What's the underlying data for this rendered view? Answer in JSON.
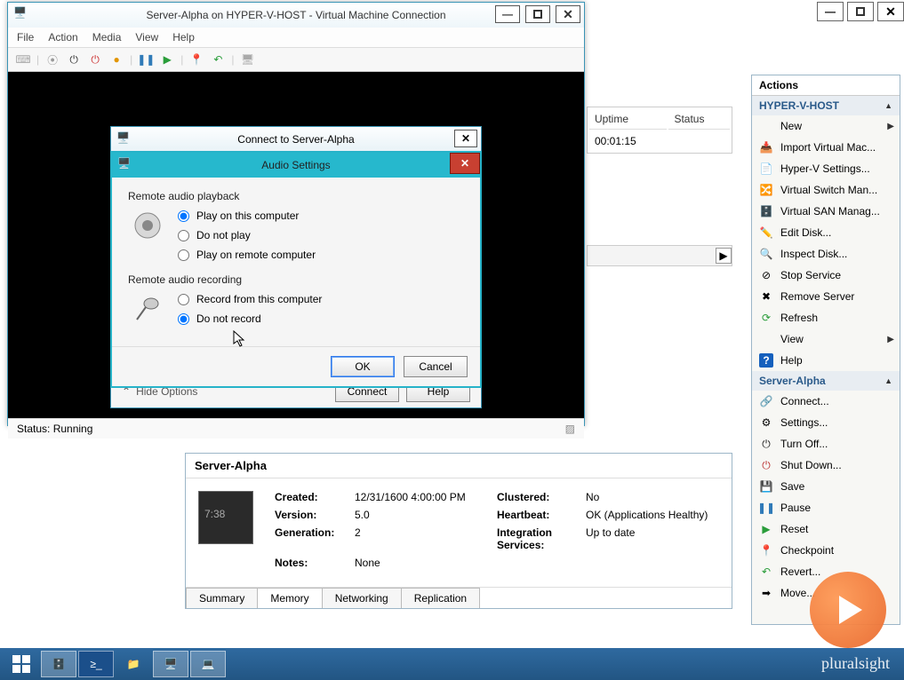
{
  "host_window": {
    "min": "—",
    "max": "❐",
    "close": "✕"
  },
  "vmconnect": {
    "title": "Server-Alpha on HYPER-V-HOST - Virtual Machine Connection",
    "menu": {
      "file": "File",
      "action": "Action",
      "media": "Media",
      "view": "View",
      "help": "Help"
    },
    "status_label": "Status: Running"
  },
  "connect_dlg": {
    "title": "Connect to Server-Alpha",
    "hide_options": "Hide Options",
    "connect": "Connect",
    "help": "Help"
  },
  "audio_dlg": {
    "title": "Audio Settings",
    "playback_label": "Remote audio playback",
    "playback_opt1": "Play on this computer",
    "playback_opt2": "Do not play",
    "playback_opt3": "Play on remote computer",
    "recording_label": "Remote audio recording",
    "recording_opt1": "Record from this computer",
    "recording_opt2": "Do not record",
    "ok": "OK",
    "cancel": "Cancel"
  },
  "vm_list": {
    "col_uptime": "Uptime",
    "col_status": "Status",
    "row0_uptime": "00:01:15"
  },
  "vm_details": {
    "name": "Server-Alpha",
    "thumb_time": "7:38",
    "created_lbl": "Created:",
    "created_val": "12/31/1600 4:00:00 PM",
    "version_lbl": "Version:",
    "version_val": "5.0",
    "generation_lbl": "Generation:",
    "generation_val": "2",
    "notes_lbl": "Notes:",
    "notes_val": "None",
    "clustered_lbl": "Clustered:",
    "clustered_val": "No",
    "heartbeat_lbl": "Heartbeat:",
    "heartbeat_val": "OK (Applications Healthy)",
    "integ_lbl": "Integration Services:",
    "integ_val": "Up to date",
    "tabs": {
      "summary": "Summary",
      "memory": "Memory",
      "networking": "Networking",
      "replication": "Replication"
    }
  },
  "actions": {
    "title": "Actions",
    "host_section": "HYPER-V-HOST",
    "vm_section": "Server-Alpha",
    "new": "New",
    "import": "Import Virtual Mac...",
    "hvsettings": "Hyper-V Settings...",
    "vswitch": "Virtual Switch Man...",
    "vsan": "Virtual SAN Manag...",
    "editdisk": "Edit Disk...",
    "inspectdisk": "Inspect Disk...",
    "stopservice": "Stop Service",
    "removeserver": "Remove Server",
    "refresh": "Refresh",
    "view": "View",
    "help": "Help",
    "connect": "Connect...",
    "settings": "Settings...",
    "turnoff": "Turn Off...",
    "shutdown": "Shut Down...",
    "save": "Save",
    "pause": "Pause",
    "reset": "Reset",
    "checkpoint": "Checkpoint",
    "revert": "Revert...",
    "move": "Move..."
  },
  "brand": "pluralsight"
}
